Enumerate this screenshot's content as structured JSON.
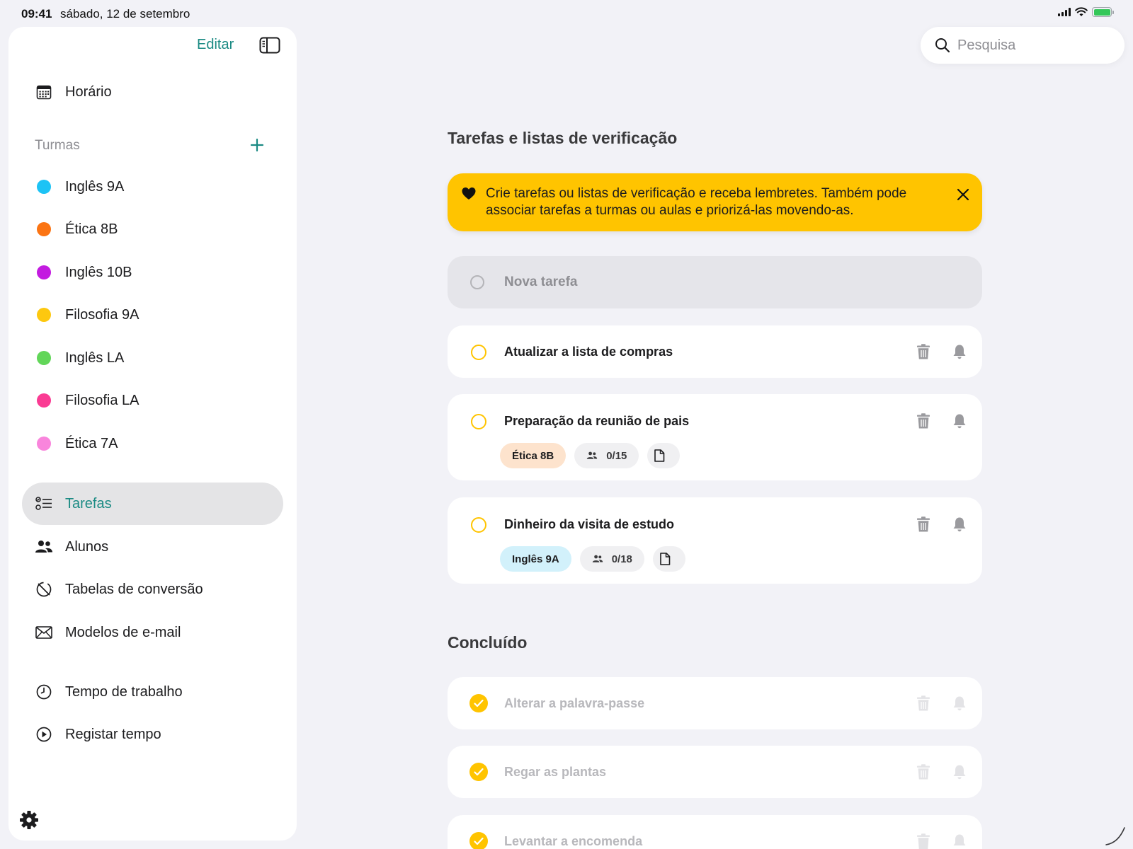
{
  "status_bar": {
    "time": "09:41",
    "date": "sábado, 12 de setembro"
  },
  "sidebar": {
    "edit_label": "Editar",
    "schedule_label": "Horário",
    "classes_title": "Turmas",
    "classes": [
      {
        "label": "Inglês 9A",
        "color": "#1dc3f5"
      },
      {
        "label": "Ética 8B",
        "color": "#fb7413"
      },
      {
        "label": "Inglês 10B",
        "color": "#c31be0"
      },
      {
        "label": "Filosofia 9A",
        "color": "#fdc80f"
      },
      {
        "label": "Inglês LA",
        "color": "#62d659"
      },
      {
        "label": "Filosofia LA",
        "color": "#fa3b93"
      },
      {
        "label": "Ética 7A",
        "color": "#f985dc"
      }
    ],
    "nav": [
      {
        "label": "Tarefas",
        "icon": "checklist-icon",
        "selected": true
      },
      {
        "label": "Alunos",
        "icon": "people-icon"
      },
      {
        "label": "Tabelas de conversão",
        "icon": "conversion-icon"
      },
      {
        "label": "Modelos de e-mail",
        "icon": "envelope-icon"
      }
    ],
    "time_nav": [
      {
        "label": "Tempo de trabalho",
        "icon": "clock-icon"
      },
      {
        "label": "Registar tempo",
        "icon": "play-circle-icon"
      }
    ]
  },
  "search": {
    "placeholder": "Pesquisa"
  },
  "main": {
    "title": "Tarefas e listas de verificação",
    "banner_text": "Crie tarefas ou listas de verificação e receba lembretes. Também pode associar tarefas a turmas ou aulas e priorizá-las movendo-as.",
    "new_task_placeholder": "Nova tarefa",
    "tasks": [
      {
        "title": "Atualizar a lista de compras"
      },
      {
        "title": "Preparação da reunião de pais",
        "class_tag": "Ética 8B",
        "students": "0/15"
      },
      {
        "title": "Dinheiro da visita de estudo",
        "class_tag": "Inglês 9A",
        "students": "0/18"
      }
    ],
    "completed_title": "Concluído",
    "completed": [
      {
        "title": "Alterar a palavra-passe"
      },
      {
        "title": "Regar as plantas"
      },
      {
        "title": "Levantar a encomenda"
      }
    ]
  },
  "colors": {
    "accent": "#1a8a83",
    "highlight": "#ffc400"
  }
}
